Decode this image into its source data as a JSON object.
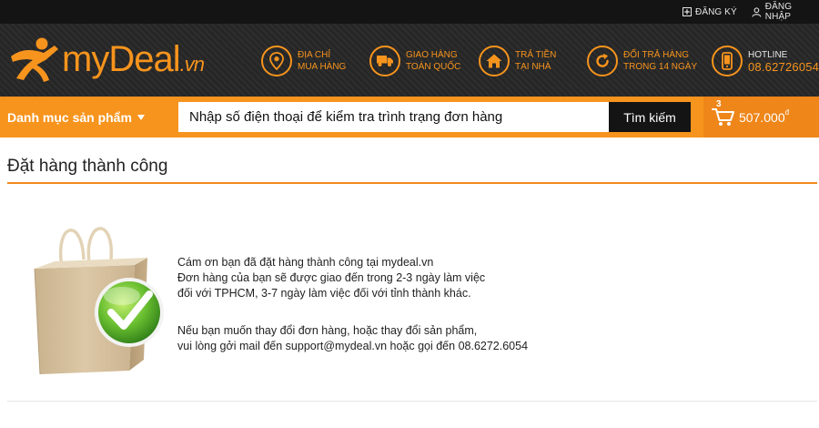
{
  "topbar": {
    "register_label": "ĐĂNG KÝ",
    "login_label": "ĐĂNG NHẬP"
  },
  "header": {
    "logo": {
      "my": "my",
      "deal": "Deal",
      "vn": ".vn"
    },
    "features": [
      {
        "icon": "location-pin-icon",
        "line1": "ĐỊA CHỈ",
        "line2": "MUA HÀNG"
      },
      {
        "icon": "delivery-truck-icon",
        "line1": "GIAO HÀNG",
        "line2": "TOÀN QUỐC"
      },
      {
        "icon": "home-icon",
        "line1": "TRẢ TIỀN",
        "line2": "TẠI NHÀ"
      },
      {
        "icon": "return-arrow-icon",
        "line1": "ĐỔI TRẢ HÀNG",
        "line2": "TRONG 14 NGÀY"
      }
    ],
    "hotline": {
      "icon": "mobile-phone-icon",
      "label": "HOTLINE",
      "phone": "08.62726054"
    }
  },
  "nav": {
    "category_label": "Danh mục sản phẩm",
    "search_placeholder": "Nhập số điện thoại để kiểm tra trình trạng đơn hàng",
    "search_button": "Tìm kiếm",
    "cart_count": "3",
    "cart_total": "507.000",
    "currency_symbol": "đ"
  },
  "content": {
    "title": "Đặt hàng thành công",
    "message_lines_1": [
      "Cám ơn bạn đã đặt hàng thành công tại mydeal.vn",
      "Đơn hàng của bạn sẽ được giao đến trong 2-3 ngày làm việc",
      "đối với TPHCM, 3-7 ngày làm việc đối với tỉnh thành khác."
    ],
    "message_lines_2": [
      "Nếu bạn muốn thay đổi đơn hàng, hoặc thay đổi sản phẩm,",
      "vui lòng gởi mail đến support@mydeal.vn hoặc gọi đến 08.6272.6054"
    ]
  },
  "colors": {
    "accent": "#f7941d",
    "topbar_bg": "#141414",
    "header_bg": "#262626",
    "check_green": "#5fb731"
  }
}
